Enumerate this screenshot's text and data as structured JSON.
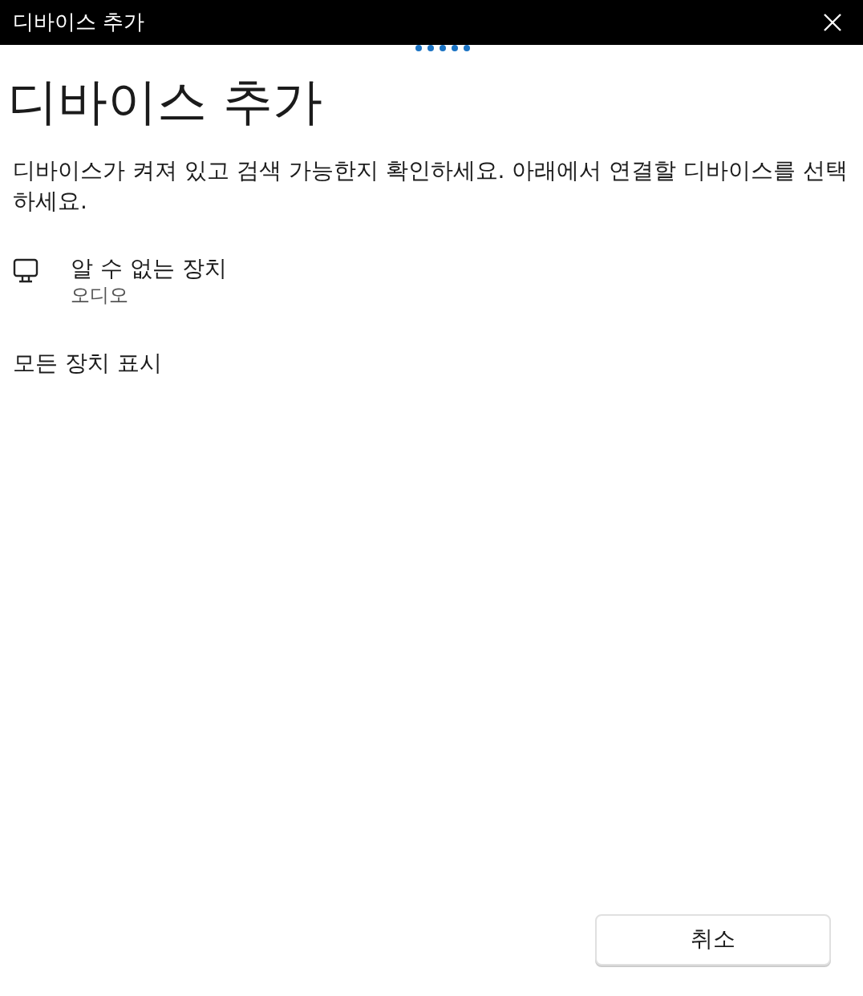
{
  "window": {
    "title": "디바이스 추가"
  },
  "heading": "디바이스 추가",
  "description": "디바이스가 켜져 있고 검색 가능한지 확인하세요. 아래에서 연결할 디바이스를 선택하세요.",
  "devices": [
    {
      "name": "알 수 없는 장치",
      "type": "오디오"
    }
  ],
  "show_all": "모든 장치 표시",
  "buttons": [
    "취소"
  ]
}
